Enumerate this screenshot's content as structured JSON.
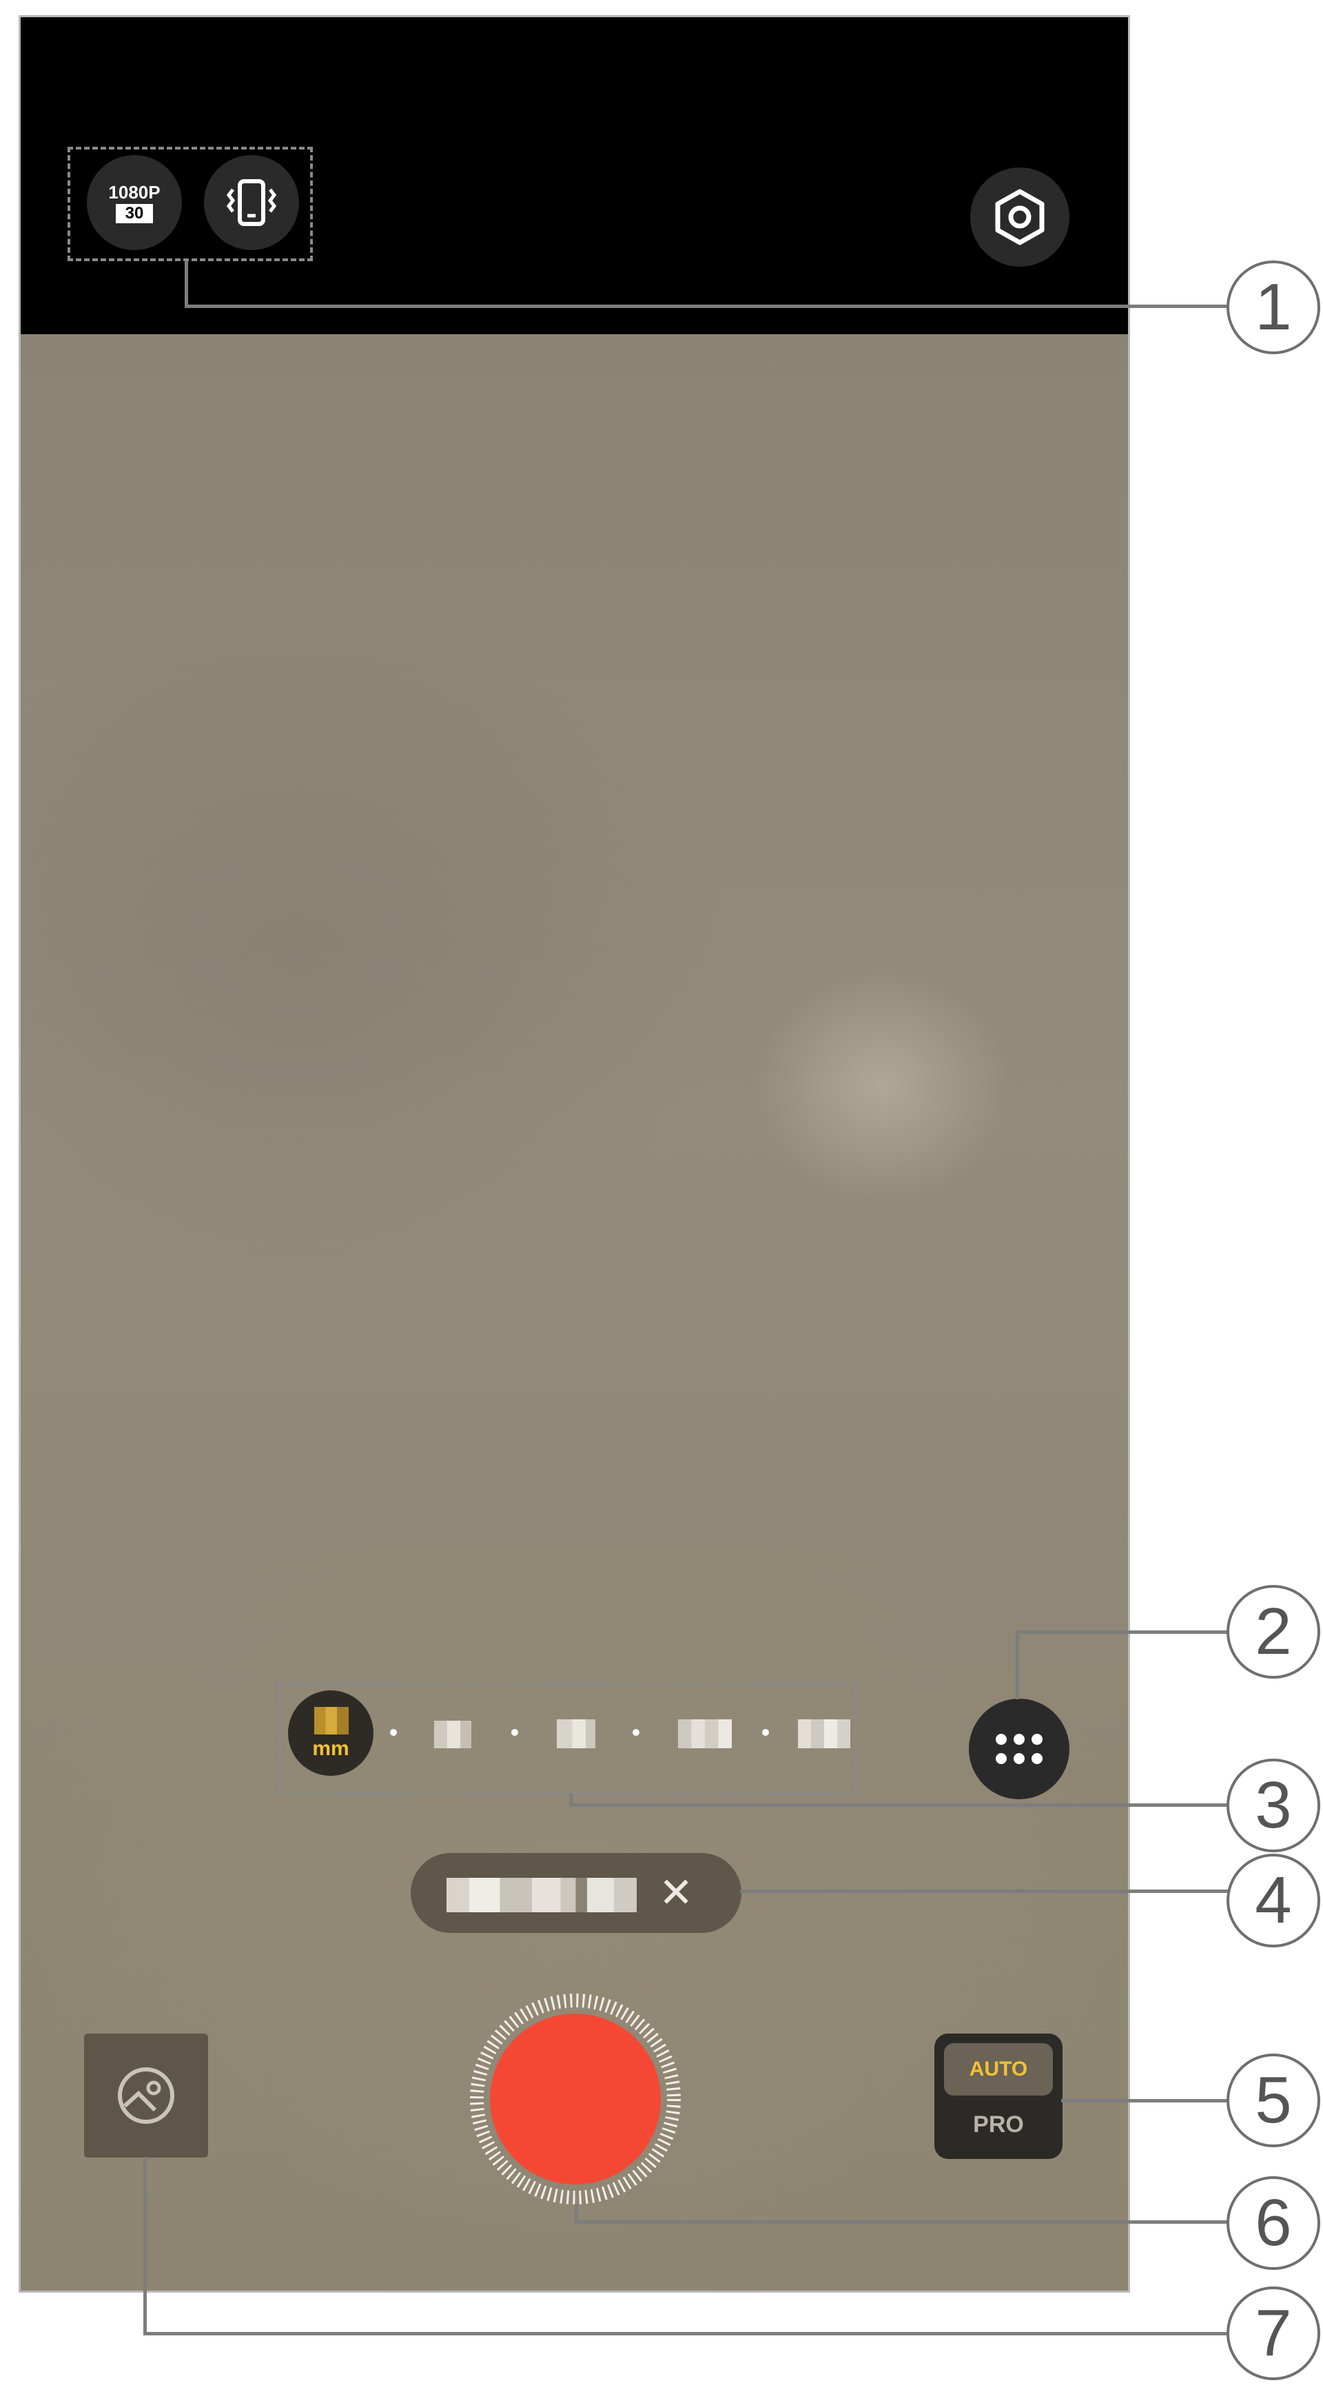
{
  "top_bar": {
    "resolution_top": "1080P",
    "resolution_bottom": "30",
    "icons": [
      "resolution-fps-icon",
      "vibration-phone-icon",
      "settings-hexagon-icon"
    ]
  },
  "lens_selector": {
    "active_unit": "mm"
  },
  "mode_chip": {
    "close_glyph": "✕"
  },
  "mode_switch": {
    "auto_label": "AUTO",
    "pro_label": "PRO"
  },
  "callouts": [
    "1",
    "2",
    "3",
    "4",
    "5",
    "6",
    "7"
  ],
  "colors": {
    "record": "#f44834",
    "accent_yellow": "#f2c230",
    "top_bar": "#000000",
    "viewfinder": "#8f8678"
  }
}
